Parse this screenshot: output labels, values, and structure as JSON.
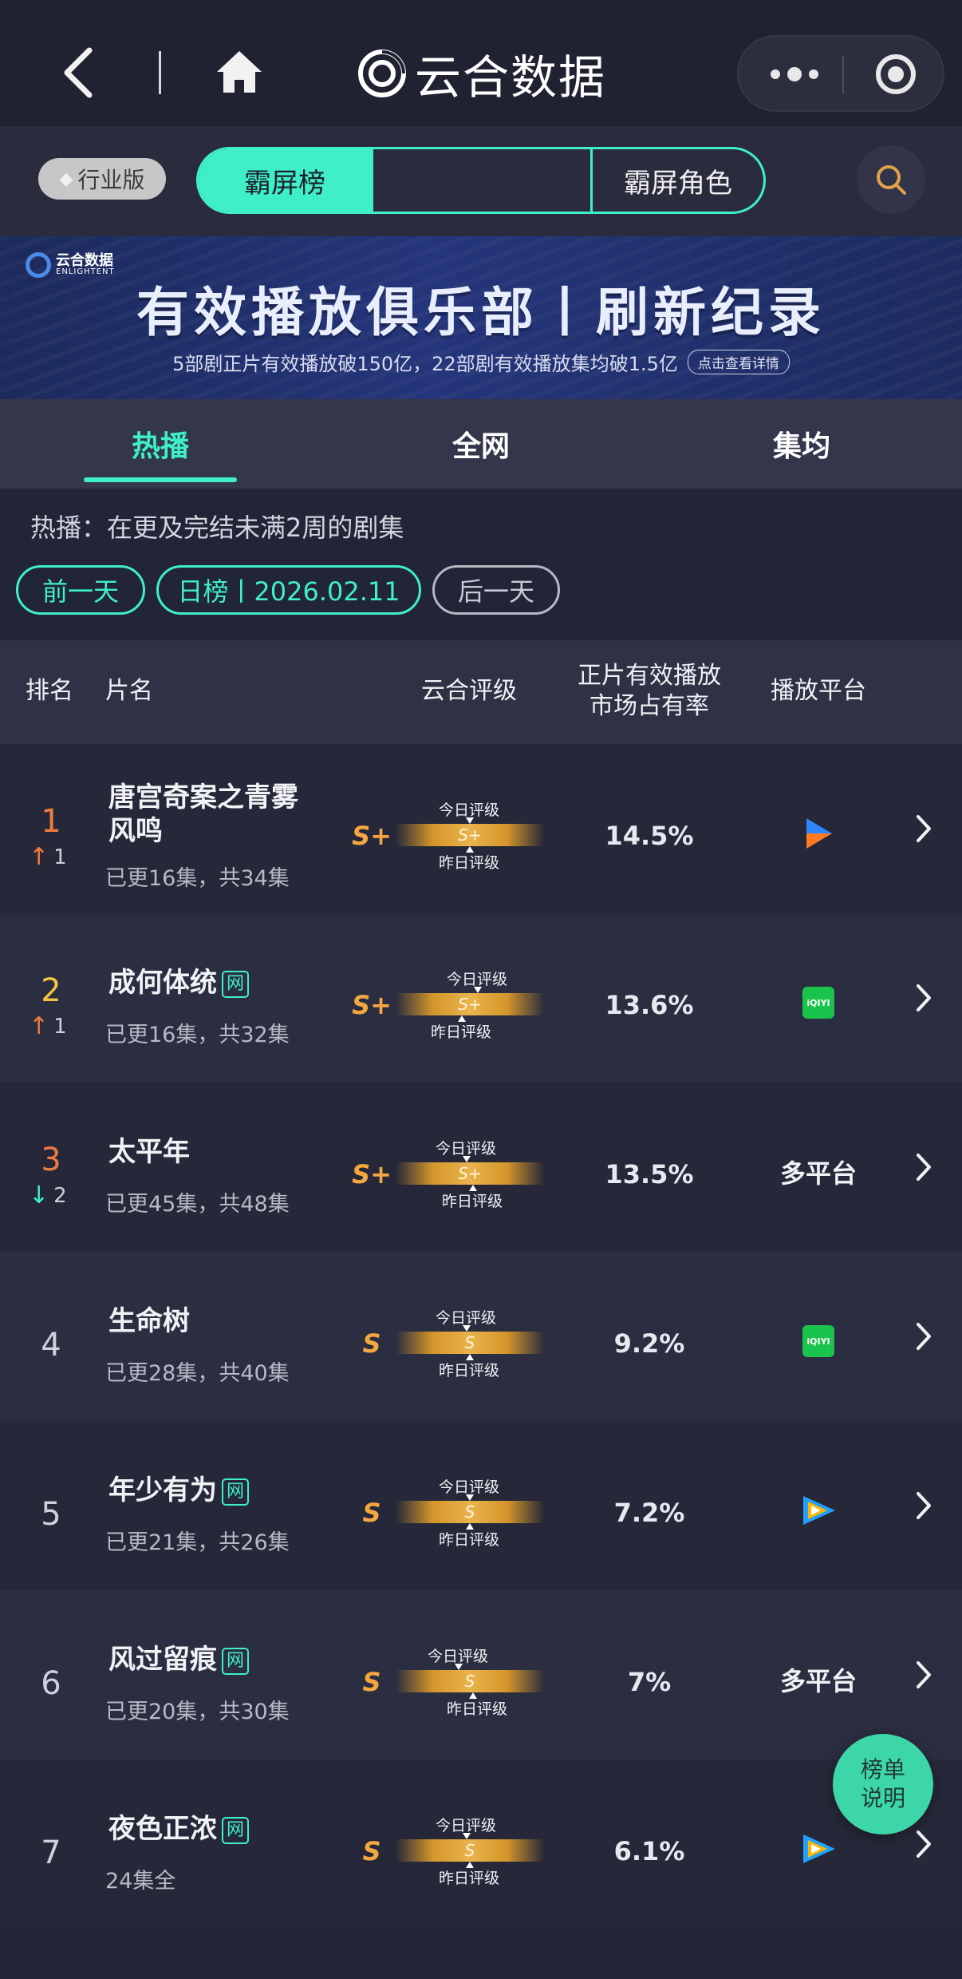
{
  "header": {
    "app_name": "云合数据"
  },
  "selector": {
    "industry_badge": "行业版",
    "tabs": [
      "霸屏榜",
      "",
      "霸屏角色"
    ],
    "active_tab": "霸屏榜"
  },
  "banner": {
    "logo_text": "云合数据",
    "logo_en": "ENLIGHTENT",
    "title": "有效播放俱乐部丨刷新纪录",
    "subtitle": "5部剧正片有效播放破150亿，22部剧有效播放集均破1.5亿",
    "detail_link": "点击查看详情"
  },
  "category_tabs": [
    "热播",
    "全网",
    "集均"
  ],
  "active_category": "热播",
  "description": "热播：在更及完结未满2周的剧集",
  "date_controls": {
    "prev": "前一天",
    "current": "日榜丨2026.02.11",
    "next": "后一天"
  },
  "table_header": {
    "rank": "排名",
    "name": "片名",
    "rating": "云合评级",
    "share_line1": "正片有效播放",
    "share_line2": "市场占有率",
    "platform": "播放平台"
  },
  "gauge_labels": {
    "today": "今日评级",
    "yesterday": "昨日评级"
  },
  "rows": [
    {
      "rank": "1",
      "delta": "1",
      "delta_dir": "up",
      "title": "唐宫奇案之青雾风鸣",
      "net": "",
      "episodes": "已更16集，共34集",
      "grade": "S+",
      "share": "14.5%",
      "platform_type": "youku-icon",
      "platform_text": ""
    },
    {
      "rank": "2",
      "delta": "1",
      "delta_dir": "up",
      "title": "成何体统",
      "net": "网",
      "episodes": "已更16集，共32集",
      "grade": "S+",
      "share": "13.6%",
      "platform_type": "iqiyi-icon",
      "platform_text": "iQIYI"
    },
    {
      "rank": "3",
      "delta": "2",
      "delta_dir": "down",
      "title": "太平年",
      "net": "",
      "episodes": "已更45集，共48集",
      "grade": "S+",
      "share": "13.5%",
      "platform_type": "text",
      "platform_text": "多平台"
    },
    {
      "rank": "4",
      "delta": "",
      "delta_dir": "",
      "title": "生命树",
      "net": "",
      "episodes": "已更28集，共40集",
      "grade": "S",
      "share": "9.2%",
      "platform_type": "iqiyi-icon",
      "platform_text": "iQIYI"
    },
    {
      "rank": "5",
      "delta": "",
      "delta_dir": "",
      "title": "年少有为",
      "net": "网",
      "episodes": "已更21集，共26集",
      "grade": "S",
      "share": "7.2%",
      "platform_type": "tencent-video-icon",
      "platform_text": ""
    },
    {
      "rank": "6",
      "delta": "",
      "delta_dir": "",
      "title": "风过留痕",
      "net": "网",
      "episodes": "已更20集，共30集",
      "grade": "S",
      "share": "7%",
      "platform_type": "text",
      "platform_text": "多平台"
    },
    {
      "rank": "7",
      "delta": "",
      "delta_dir": "",
      "title": "夜色正浓",
      "net": "网",
      "episodes": "24集全",
      "grade": "S",
      "share": "6.1%",
      "platform_type": "tencent-video-icon",
      "platform_text": ""
    }
  ],
  "float_button": {
    "line1": "榜单",
    "line2": "说明"
  },
  "colors": {
    "accent": "#3ff0c6",
    "grade": "#f4a640",
    "rank_up": "#f07b3f",
    "background": "#222437"
  }
}
